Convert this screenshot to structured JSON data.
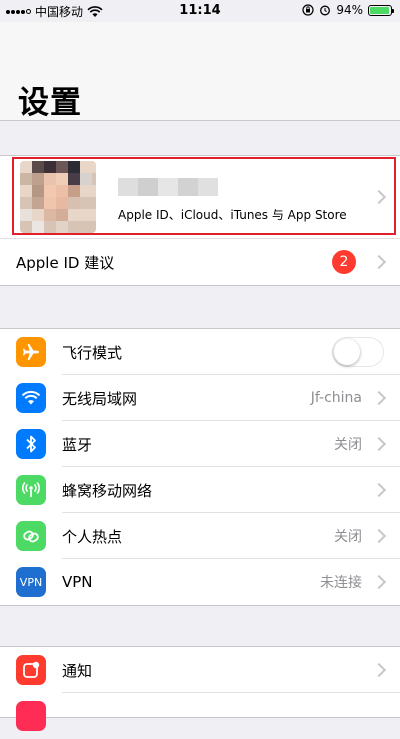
{
  "status_bar": {
    "carrier": "中国移动",
    "time": "11:14",
    "battery_percent": "94%",
    "battery_level": 0.94
  },
  "title": "设置",
  "profile": {
    "subtitle": "Apple ID、iCloud、iTunes 与 App Store"
  },
  "suggestion": {
    "label": "Apple ID 建议",
    "badge": "2"
  },
  "connectivity": [
    {
      "label": "飞行模式",
      "icon": "airplane-icon",
      "color": "#ff9500",
      "toggle": false
    },
    {
      "label": "无线局域网",
      "icon": "wifi-icon",
      "color": "#007aff",
      "detail": "Jf-china"
    },
    {
      "label": "蓝牙",
      "icon": "bluetooth-icon",
      "color": "#007aff",
      "detail": "关闭"
    },
    {
      "label": "蜂窝移动网络",
      "icon": "cellular-icon",
      "color": "#4cd964",
      "detail": ""
    },
    {
      "label": "个人热点",
      "icon": "hotspot-icon",
      "color": "#4cd964",
      "detail": "关闭"
    },
    {
      "label": "VPN",
      "icon": "vpn-icon",
      "icon_text": "VPN",
      "color": "#1f6fd1",
      "detail": "未连接"
    }
  ],
  "notifications": {
    "label": "通知",
    "icon": "notifications-icon",
    "color": "#ff3b30"
  }
}
